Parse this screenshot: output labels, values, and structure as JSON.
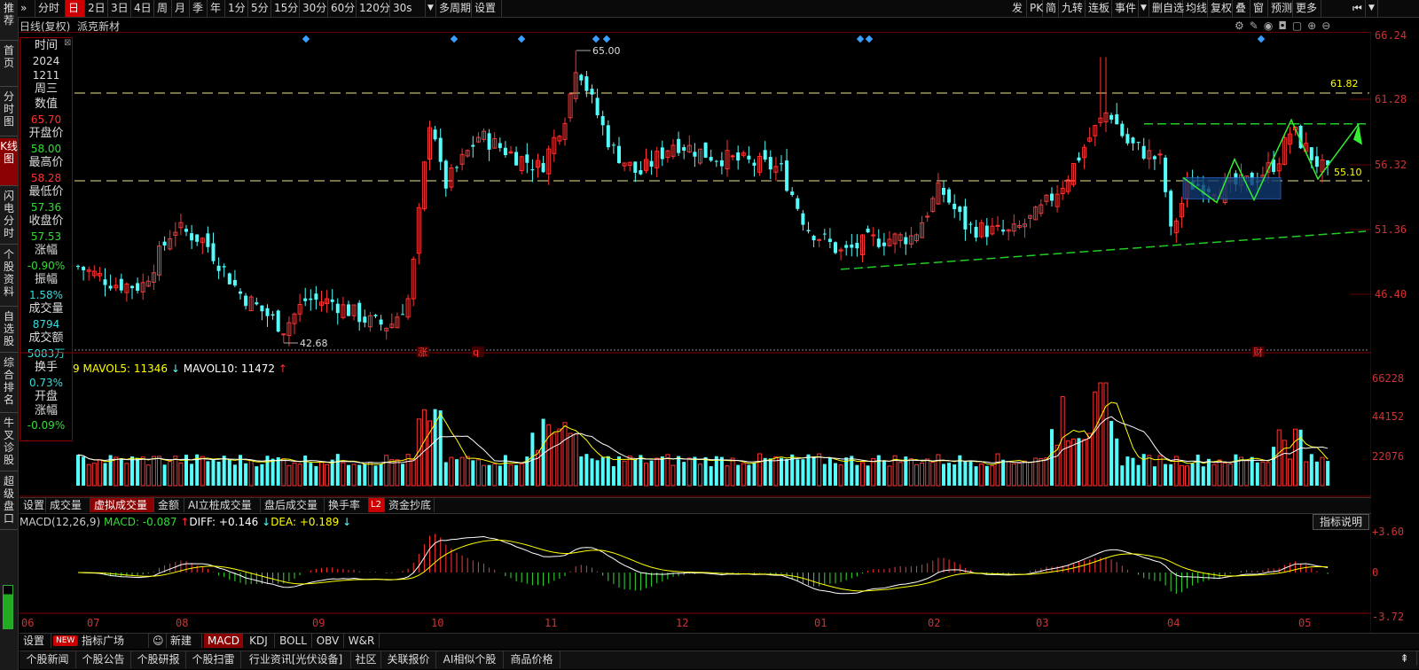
{
  "left_nav": [
    "推荐",
    "首页",
    "分时图",
    "K线图",
    "闪电分时",
    "个股资料",
    "自选股",
    "综合排名",
    "牛叉诊股",
    "超级盘口"
  ],
  "left_nav_active": "K线图",
  "topbar": {
    "left_items": [
      "分时",
      "日",
      "2日",
      "3日",
      "4日",
      "周",
      "月",
      "季",
      "年",
      "1分",
      "5分",
      "15分",
      "30分",
      "60分",
      "120分",
      "30s",
      "多周期",
      "设置"
    ],
    "active": "日",
    "right_items": [
      "发",
      "PK",
      "简",
      "九转",
      "连板",
      "事件",
      "删自选",
      "均线",
      "复权",
      "叠",
      "窗",
      "预测",
      "更多"
    ]
  },
  "subtitle": {
    "mode": "日线(复权)",
    "stock_name": "派克新材"
  },
  "info_panel": [
    {
      "label": "时间",
      "values": [
        "2024",
        "1211"
      ],
      "color": "#dddddd"
    },
    {
      "label": "周三",
      "values": [],
      "color": "#dddddd"
    },
    {
      "label": "数值",
      "values": [
        "65.70"
      ],
      "color": "#ff3333"
    },
    {
      "label": "开盘价",
      "values": [
        "58.00"
      ],
      "color": "#33dd33"
    },
    {
      "label": "最高价",
      "values": [
        "58.28"
      ],
      "color": "#ff3333"
    },
    {
      "label": "最低价",
      "values": [
        "57.36"
      ],
      "color": "#33dd33"
    },
    {
      "label": "收盘价",
      "values": [
        "57.53"
      ],
      "color": "#33dd33"
    },
    {
      "label": "涨幅",
      "values": [
        "-0.90%"
      ],
      "color": "#33dd33"
    },
    {
      "label": "振幅",
      "values": [
        "1.58%"
      ],
      "color": "#33dddd"
    },
    {
      "label": "成交量",
      "values": [
        "8794"
      ],
      "color": "#33dddd"
    },
    {
      "label": "成交额",
      "values": [
        "5083万"
      ],
      "color": "#33dddd"
    },
    {
      "label": "换手",
      "values": [
        "0.73%"
      ],
      "color": "#33dddd"
    },
    {
      "label": "开盘涨幅",
      "values": [
        "-0.09%"
      ],
      "color": "#33dd33"
    }
  ],
  "price_axis": [
    "66.24",
    "61.28",
    "56.32",
    "51.36",
    "46.40"
  ],
  "volume_axis": [
    "66228",
    "44152",
    "22076"
  ],
  "macd_axis": [
    "3.60",
    "0",
    "-3.72"
  ],
  "price_annotations": {
    "high": "65.00",
    "low": "42.68",
    "fib_top": "61.82",
    "fib_mid": "55.10"
  },
  "event_markers": {
    "zhang": "涨",
    "q": "q",
    "cai": "财"
  },
  "volume_legend": {
    "prefix": "9",
    "mavol5": "MAVOL5: 11346",
    "mavol10": "MAVOL10: 11472"
  },
  "volume_tabs": [
    "设置",
    "成交量",
    "虚拟成交量",
    "金额",
    "AI立桩成交量",
    "盘后成交量",
    "换手率",
    "L2",
    "资金抄底"
  ],
  "volume_tab_active": "虚拟成交量",
  "macd_legend": {
    "name": "MACD(12,26,9)",
    "macd": "MACD: -0.087",
    "diff": "DIFF: +0.146",
    "dea": "DEA: +0.189"
  },
  "indicator_help": "指标说明",
  "month_labels": [
    "06",
    "07",
    "08",
    "09",
    "10",
    "11",
    "12",
    "01",
    "02",
    "03",
    "04",
    "05"
  ],
  "indicator_tabs": {
    "settings": "设置",
    "new_badge": "NEW",
    "plaza": "指标广场",
    "create": "新建",
    "items": [
      "MACD",
      "KDJ",
      "BOLL",
      "OBV",
      "W&R"
    ],
    "active": "MACD"
  },
  "news_tabs": [
    "个股新闻",
    "个股公告",
    "个股研报",
    "个股扫雷",
    "行业资讯[光伏设备]",
    "社区",
    "关联报价",
    "AI相似个股",
    "商品价格"
  ],
  "colors": {
    "up": "#ff3333",
    "down": "#54fcfc",
    "ma5": "#ffffff",
    "ma10": "#ffff00",
    "accent": "#c00000"
  },
  "chart_data": {
    "type": "candlestick",
    "y_range": [
      42.0,
      66.5
    ],
    "series_note": "daily candles Jun 2024 – May 2025",
    "highlights": {
      "period_high": 65.0,
      "period_low": 42.68,
      "last_close": 57.53
    }
  }
}
